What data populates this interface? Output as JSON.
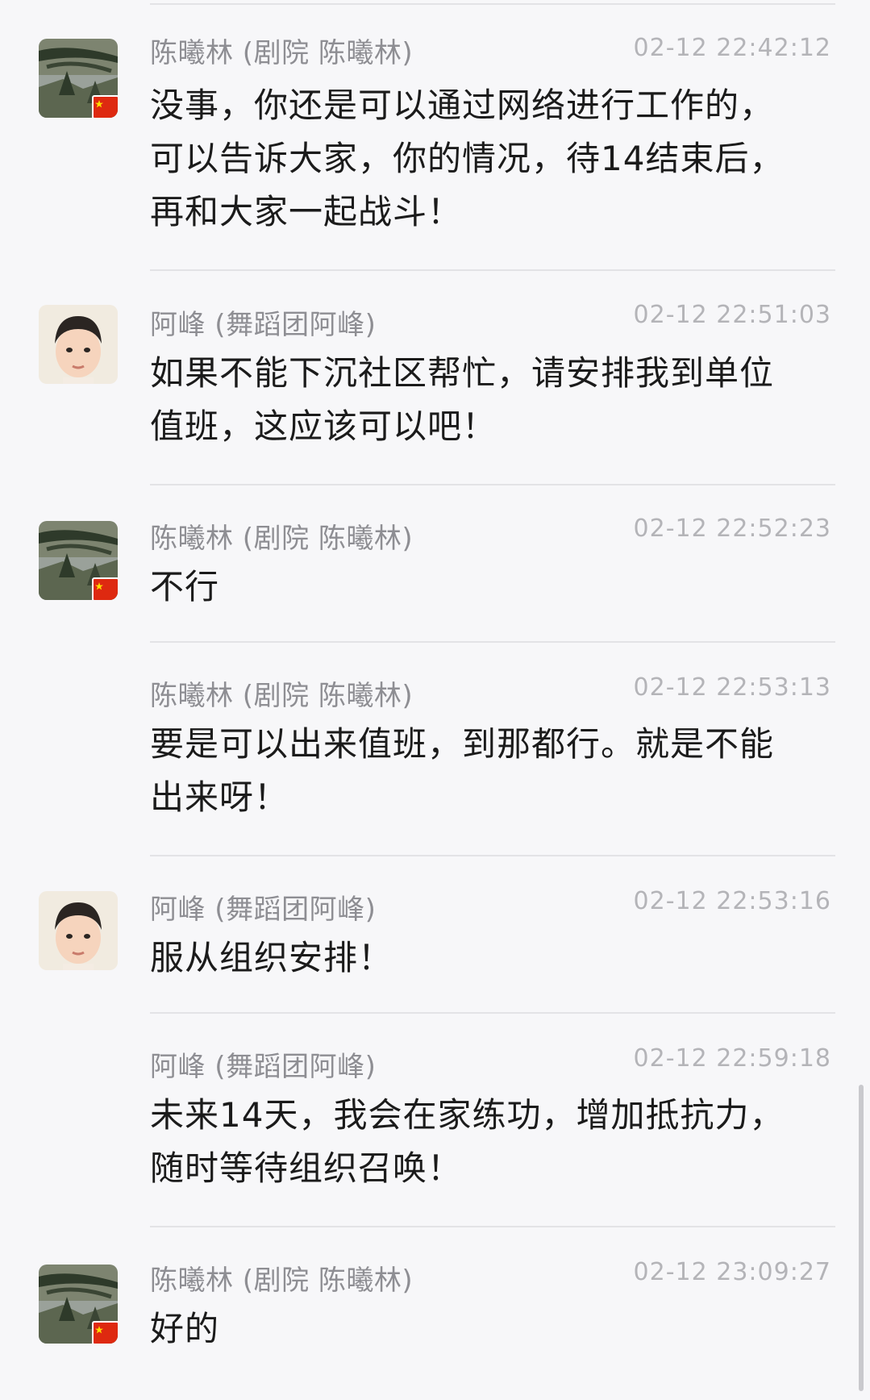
{
  "messages": [
    {
      "sender": "陈曦林 (剧院 陈曦林)",
      "time": "02-12 22:42:12",
      "text": "没事，你还是可以通过网络进行工作的，\n可以告诉大家，你的情况，待14结束后，\n再和大家一起战斗！",
      "avatar": "landscape-avatar-with-flag"
    },
    {
      "sender": "阿峰 (舞蹈团阿峰)",
      "time": "02-12 22:51:03",
      "text": "如果不能下沉社区帮忙，请安排我到单位\n值班，这应该可以吧！",
      "avatar": "boy-portrait-avatar"
    },
    {
      "sender": "陈曦林 (剧院 陈曦林)",
      "time": "02-12 22:52:23",
      "text": "不行",
      "avatar": "landscape-avatar-with-flag"
    },
    {
      "sender": "陈曦林 (剧院 陈曦林)",
      "time": "02-12 22:53:13",
      "text": "要是可以出来值班，到那都行。就是不能\n出来呀！",
      "avatar": ""
    },
    {
      "sender": "阿峰 (舞蹈团阿峰)",
      "time": "02-12 22:53:16",
      "text": "服从组织安排！",
      "avatar": "boy-portrait-avatar"
    },
    {
      "sender": "阿峰 (舞蹈团阿峰)",
      "time": "02-12 22:59:18",
      "text": "未来14天，我会在家练功，增加抵抗力，\n随时等待组织召唤！",
      "avatar": ""
    },
    {
      "sender": "陈曦林 (剧院 陈曦林)",
      "time": "02-12 23:09:27",
      "text": "好的",
      "avatar": "landscape-avatar-with-flag"
    }
  ],
  "colors": {
    "background": "#f7f7f9",
    "divider": "#e3e3e6",
    "sender": "#8e8e93",
    "timestamp": "#b4b4b8",
    "text": "#1b1b1b",
    "flag": "#de2910"
  }
}
